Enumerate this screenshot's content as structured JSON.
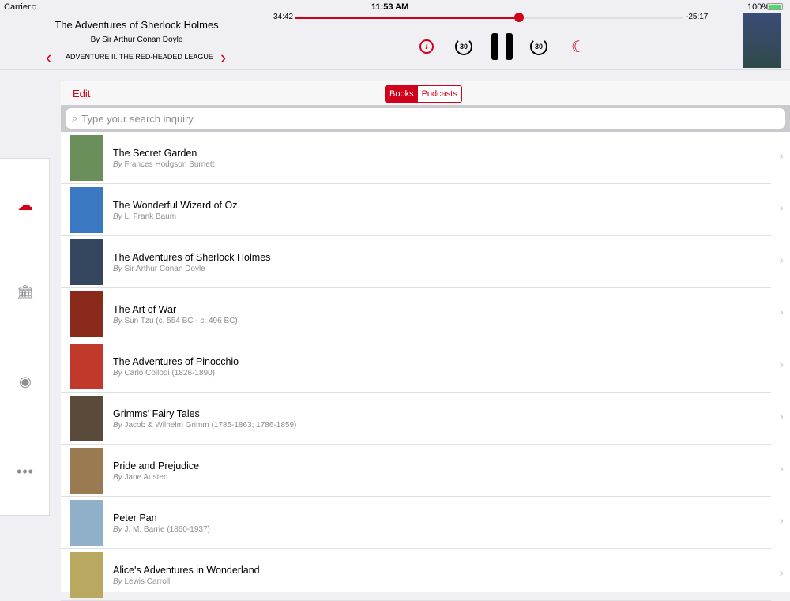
{
  "status": {
    "carrier": "Carrier",
    "time": "11:53 AM",
    "battery": "100%"
  },
  "player": {
    "title": "The Adventures of Sherlock Holmes",
    "author": "By Sir Arthur Conan Doyle",
    "chapter": "ADVENTURE  II.  THE RED-HEADED LEAGUE",
    "elapsed": "34:42",
    "remaining": "-25:17",
    "progress": 0.578,
    "skip_back": "30",
    "skip_forward": "30"
  },
  "toolbar": {
    "edit": "Edit",
    "segments": [
      "Books",
      "Podcasts"
    ],
    "search_placeholder": "Type your search inquiry"
  },
  "books": [
    {
      "title": "The Secret Garden",
      "by": "By",
      "author": "Frances Hodgson Burnett",
      "color": "#6b8f5a"
    },
    {
      "title": "The Wonderful Wizard of Oz",
      "by": "By",
      "author": "L. Frank Baum",
      "color": "#3a78c2"
    },
    {
      "title": "The Adventures of Sherlock Holmes",
      "by": "By",
      "author": "Sir Arthur Conan Doyle",
      "color": "#34475e"
    },
    {
      "title": "The Art of War",
      "by": "By",
      "author": "Sun Tzu (c. 554 BC - c. 496 BC)",
      "color": "#8a2a1a"
    },
    {
      "title": "The Adventures of Pinocchio",
      "by": "By",
      "author": "Carlo Collodi (1826-1890)",
      "color": "#c0392b"
    },
    {
      "title": "Grimms' Fairy Tales",
      "by": "By",
      "author": "Jacob & Wilhelm Grimm (1785-1863; 1786-1859)",
      "color": "#5a4a3a"
    },
    {
      "title": "Pride and Prejudice",
      "by": "By",
      "author": "Jane Austen",
      "color": "#9a7a50"
    },
    {
      "title": " Peter Pan",
      "by": "By",
      "author": " J. M. Barrie (1860-1937)",
      "color": "#8fb0c8"
    },
    {
      "title": "Alice's Adventures in Wonderland",
      "by": "By",
      "author": "Lewis Carroll",
      "color": "#b8a860"
    }
  ]
}
